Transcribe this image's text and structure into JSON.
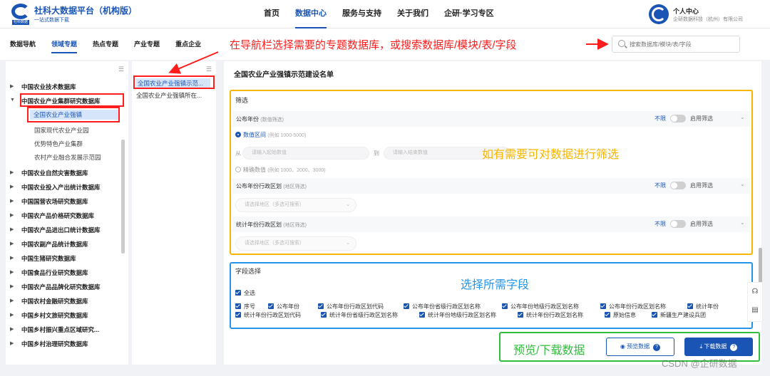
{
  "header": {
    "brand_title": "社科大数据平台（机构版）",
    "brand_sub": "一站式数据下载",
    "logo_tag": "社科数据",
    "nav": [
      "首页",
      "数据中心",
      "服务与支持",
      "关于我们",
      "企研·学习专区"
    ],
    "active_nav": "数据中心",
    "user_name": "个人中心",
    "user_org": "企研数据科技（杭州）有限公司"
  },
  "subnav": {
    "tabs": [
      "数据导航",
      "领域专题",
      "热点专题",
      "产业专题",
      "重点企业"
    ],
    "active_tab": "领域专题",
    "search_placeholder": "搜索数据库/模块/表/字段"
  },
  "annotations": {
    "nav_hint": "在导航栏选择需要的专题数据库，或搜索数据库/模块/表/字段",
    "filter_hint": "如有需要可对数据进行筛选",
    "field_hint": "选择所需字段",
    "download_hint": "预览/下载数据"
  },
  "tree": {
    "items": [
      "中国农业技术数据库",
      "中国农业产业集群研究数据库",
      "中国农业自然灾害数据库",
      "中国农业投入产出统计数据库",
      "中国国营农场研究数据库",
      "中国农产品价格研究数据库",
      "中国农产品进出口统计数据库",
      "中国农副产品统计数据库",
      "中国生猪研究数据库",
      "中国食品行业研究数据库",
      "中国农产品品牌化研究数据库",
      "中国农村金融研究数据库",
      "中国乡村文旅研究数据库",
      "中国乡村振兴重点区域研究...",
      "中国乡村治理研究数据库"
    ],
    "children": [
      "全国农业产业强镇",
      "国家现代农业产业园",
      "优势特色产业集群",
      "农村产业融合发展示范园"
    ]
  },
  "middle": {
    "items": [
      "全国农业产业强镇示范...",
      "全国农业产业强镇所在..."
    ]
  },
  "main": {
    "title": "全国农业产业强镇示范建设名单",
    "filter": {
      "section": "筛选",
      "unlimited": "不限",
      "enable": "启用筛选",
      "fields": [
        {
          "label": "公布年份",
          "hint": "(数值筛选)"
        },
        {
          "label": "公布年份行政区划",
          "hint": "(地区筛选)"
        },
        {
          "label": "统计年份行政区划",
          "hint": "(地区筛选)"
        }
      ],
      "range_option": "数值区间",
      "range_hint": "(例如 1000-5000)",
      "from": "从",
      "to": "到",
      "start_placeholder": "请输入起始数值",
      "end_placeholder": "请输入结束数值",
      "exact_option": "精确数值",
      "exact_hint": "(例如 1000、2000、3000)",
      "region_placeholder": "请选择地区（多选可搜索）"
    },
    "fields": {
      "section": "字段选择",
      "select_all": "全选",
      "row1": [
        "序号",
        "公布年份",
        "公布年份行政区划代码",
        "公布年份省级行政区划名称",
        "公布年份地级行政区划名称",
        "公布年份行政区划名称",
        "统计年份"
      ],
      "row2": [
        "统计年份行政区划代码",
        "统计年份省级行政区划名称",
        "统计年份地级行政区划名称",
        "统计年份行政区划名称",
        "原始信息",
        "新疆生产建设兵团"
      ]
    },
    "actions": {
      "preview": "预览数据",
      "download": "下载数据"
    }
  },
  "watermark": "CSDN @企研数据",
  "colors": {
    "accent": "#1a55b5",
    "red": "#ff1d1d",
    "orange": "#f7b500",
    "blue": "#2595ea",
    "green": "#2fbf3a"
  }
}
